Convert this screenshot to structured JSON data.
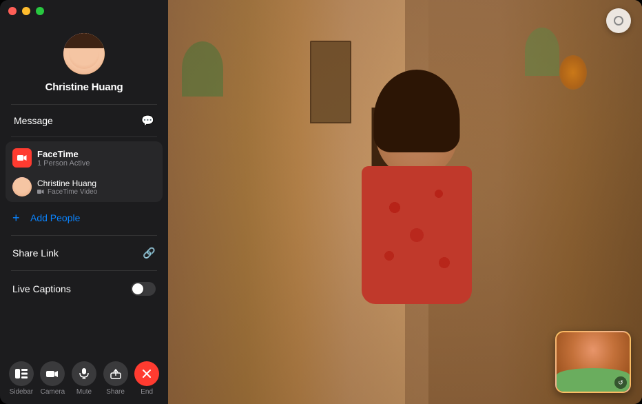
{
  "window": {
    "title": "FaceTime"
  },
  "title_bar": {
    "close": "●",
    "minimize": "●",
    "maximize": "●"
  },
  "sidebar": {
    "profile": {
      "name": "Christine Huang"
    },
    "message_label": "Message",
    "facetime_section": {
      "title": "FaceTime",
      "subtitle": "1 Person Active"
    },
    "contact": {
      "name": "Christine Huang",
      "status": "FaceTime Video"
    },
    "add_people_label": "Add People",
    "share_link_label": "Share Link",
    "live_captions_label": "Live Captions"
  },
  "toolbar": {
    "sidebar_label": "Sidebar",
    "camera_label": "Camera",
    "mute_label": "Mute",
    "share_label": "Share",
    "end_label": "End"
  }
}
